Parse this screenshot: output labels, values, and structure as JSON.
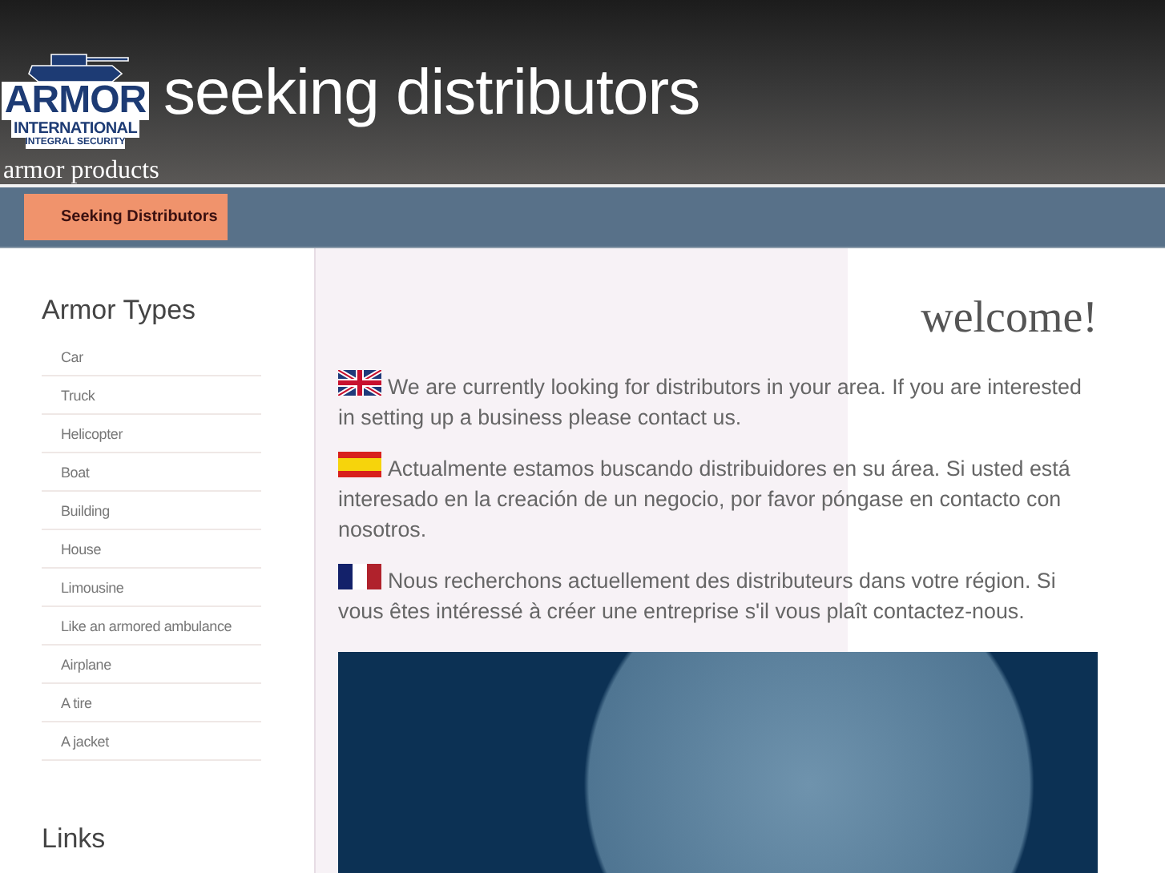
{
  "header": {
    "logo": {
      "lines": [
        "ARMOR",
        "INTERNATIONAL",
        "INTEGRAL SECURITY"
      ]
    },
    "title": "seeking distributors",
    "tagline": "armor products"
  },
  "nav": {
    "items": [
      {
        "label": "Seeking Distributors",
        "selected": true
      }
    ]
  },
  "sidebar": {
    "sections": [
      {
        "title": "Armor Types",
        "items": [
          "Car",
          "Truck",
          "Helicopter",
          "Boat",
          "Building",
          "House",
          "Limousine",
          "Like an armored ambulance",
          "Airplane",
          "A tire",
          "A jacket"
        ]
      },
      {
        "title": "Links"
      }
    ]
  },
  "content": {
    "heading": "welcome!",
    "paragraphs": [
      {
        "kind": "uk",
        "text": "We are currently looking for distributors in your area. If you are interested in setting up a business please contact us."
      },
      {
        "kind": "es",
        "text": "Actualmente estamos buscando distribuidores en su área. Si usted está interesado en la creación de un negocio, por favor póngase en contacto con nosotros."
      },
      {
        "kind": "fr",
        "text": "Nous recherchons actuellement des distributeurs dans votre région. Si vous êtes intéressé à créer une entreprise s'il vous plaît contactez-nous."
      }
    ]
  }
}
